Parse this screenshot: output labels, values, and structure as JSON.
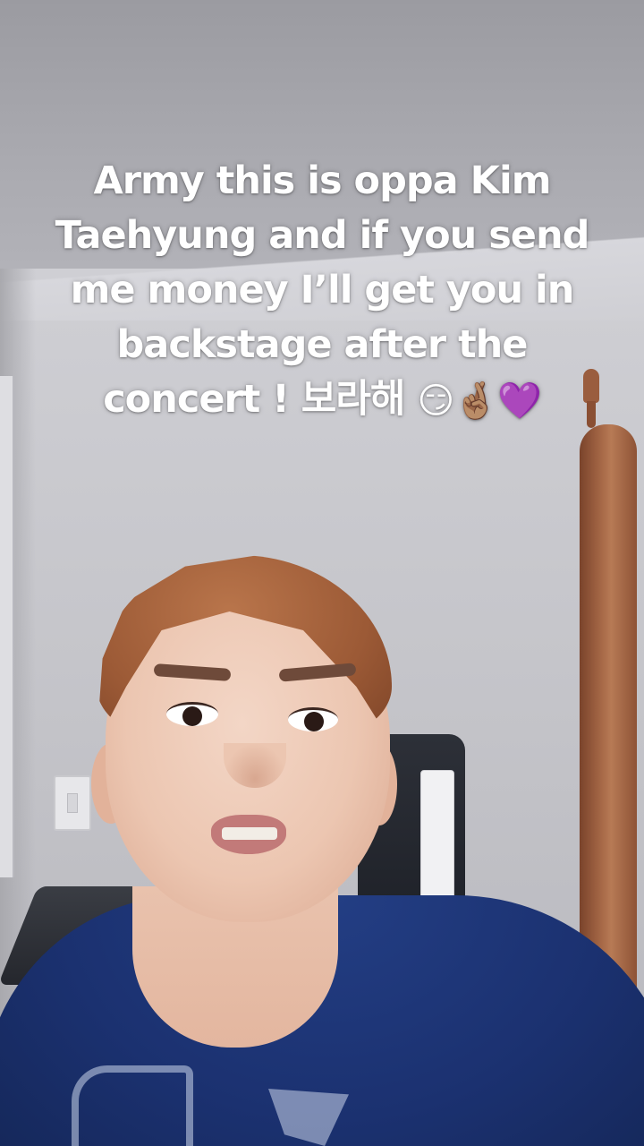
{
  "caption": {
    "text": "Army this is oppa Kim Taehyung and if you send me money I’ll get you in backstage after the concert ! 보라해",
    "emojis": [
      "😏",
      "🤞🏽",
      "💜"
    ]
  }
}
